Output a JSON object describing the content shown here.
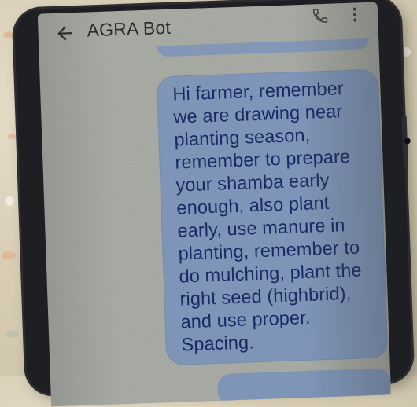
{
  "header": {
    "title": "AGRA Bot"
  },
  "message": {
    "lines": [
      "Hi farmer, remember",
      "we are drawing near",
      "planting season,",
      "remember to prepare",
      "your shamba early",
      "enough, also plant",
      "early, use manure in",
      "planting, remember to",
      "do mulching, plant the",
      "right seed (highbrid),",
      "and use proper.",
      "Spacing."
    ]
  },
  "colors": {
    "bubble": "#7f95b8",
    "message_text": "#1c2a63",
    "screen": "#a9aca5"
  }
}
